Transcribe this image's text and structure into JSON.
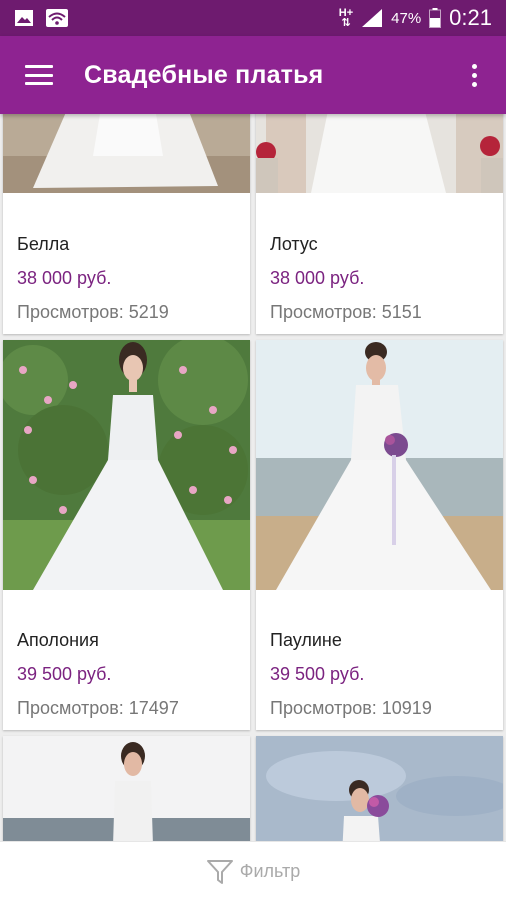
{
  "status_bar": {
    "battery": "47%",
    "time": "0:21",
    "network": "H+"
  },
  "app_bar": {
    "title": "Свадебные платья"
  },
  "products": [
    {
      "name": "Белла",
      "price": "38 000 руб.",
      "views": "Просмотров: 5219"
    },
    {
      "name": "Лотус",
      "price": "38 000 руб.",
      "views": "Просмотров: 5151"
    },
    {
      "name": "Аполония",
      "price": "39 500 руб.",
      "views": "Просмотров: 17497"
    },
    {
      "name": "Паулине",
      "price": "39 500 руб.",
      "views": "Просмотров: 10919"
    }
  ],
  "bottom_bar": {
    "filter_label": "Фильтр"
  },
  "colors": {
    "status_bar": "#6e1b6f",
    "app_bar": "#8e2391",
    "price": "#7b2380"
  },
  "icons": [
    "image-icon",
    "wifi-icon",
    "signal-icon",
    "battery-icon",
    "menu-icon",
    "more-vert-icon",
    "filter-icon"
  ]
}
